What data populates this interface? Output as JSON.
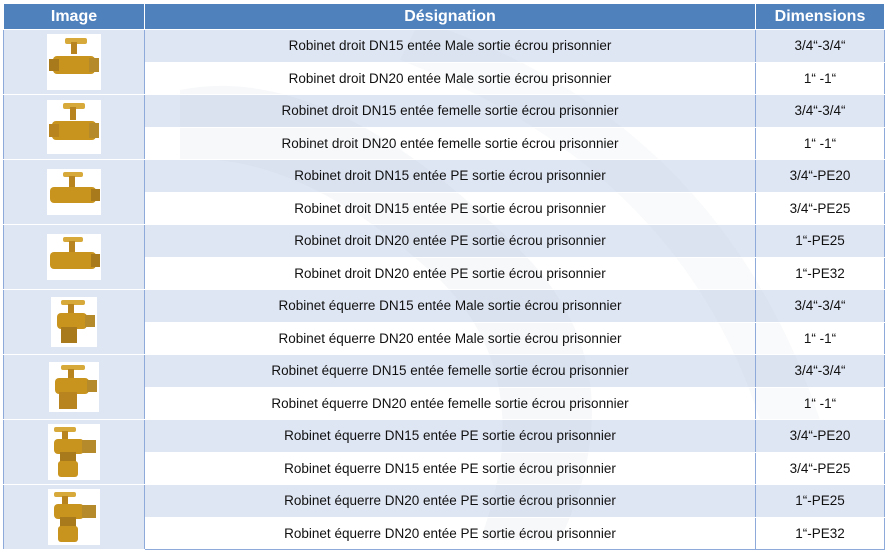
{
  "headers": {
    "image": "Image",
    "designation": "Désignation",
    "dimensions": "Dimensions"
  },
  "rows": [
    {
      "designation": "Robinet droit DN15 entée Male sortie écrou prisonnier",
      "dimensions": "3/4“-3/4“"
    },
    {
      "designation": "Robinet droit DN20 entée Male sortie écrou prisonnier",
      "dimensions": "1“ -1“"
    },
    {
      "designation": "Robinet droit DN15 entée femelle sortie écrou prisonnier",
      "dimensions": "3/4“-3/4“"
    },
    {
      "designation": "Robinet droit DN20 entée femelle sortie écrou prisonnier",
      "dimensions": "1“ -1“"
    },
    {
      "designation": "Robinet droit DN15 entée PE sortie écrou prisonnier",
      "dimensions": "3/4“-PE20"
    },
    {
      "designation": "Robinet droit DN15 entée PE sortie écrou prisonnier",
      "dimensions": "3/4“-PE25"
    },
    {
      "designation": "Robinet droit DN20 entée PE sortie écrou prisonnier",
      "dimensions": "1“-PE25"
    },
    {
      "designation": "Robinet droit DN20 entée PE sortie écrou prisonnier",
      "dimensions": "1“-PE32"
    },
    {
      "designation": "Robinet équerre DN15 entée Male sortie écrou prisonnier",
      "dimensions": "3/4“-3/4“"
    },
    {
      "designation": "Robinet équerre DN20 entée Male sortie écrou prisonnier",
      "dimensions": "1“ -1“"
    },
    {
      "designation": "Robinet équerre DN15 entée femelle sortie écrou prisonnier",
      "dimensions": "3/4“-3/4“"
    },
    {
      "designation": "Robinet équerre DN20 entée femelle sortie écrou prisonnier",
      "dimensions": "1“ -1“"
    },
    {
      "designation": "Robinet équerre DN15 entée PE sortie écrou prisonnier",
      "dimensions": "3/4“-PE20"
    },
    {
      "designation": "Robinet équerre DN15 entée PE sortie écrou prisonnier",
      "dimensions": "3/4“-PE25"
    },
    {
      "designation": "Robinet équerre DN20 entée PE sortie écrou prisonnier",
      "dimensions": "1“-PE25"
    },
    {
      "designation": "Robinet équerre DN20 entée PE sortie écrou prisonnier",
      "dimensions": "1“-PE32"
    }
  ],
  "images": [
    {
      "icon": "straight-valve-male-icon"
    },
    {
      "icon": "straight-valve-female-icon"
    },
    {
      "icon": "straight-valve-pe-icon"
    },
    {
      "icon": "straight-valve-pe-icon"
    },
    {
      "icon": "angle-valve-male-icon"
    },
    {
      "icon": "angle-valve-female-icon"
    },
    {
      "icon": "angle-valve-pe-icon"
    },
    {
      "icon": "angle-valve-pe-icon"
    }
  ],
  "colors": {
    "header": "#4f81bd",
    "row_shade": "#d2dcee",
    "brass": "#c8941e"
  }
}
